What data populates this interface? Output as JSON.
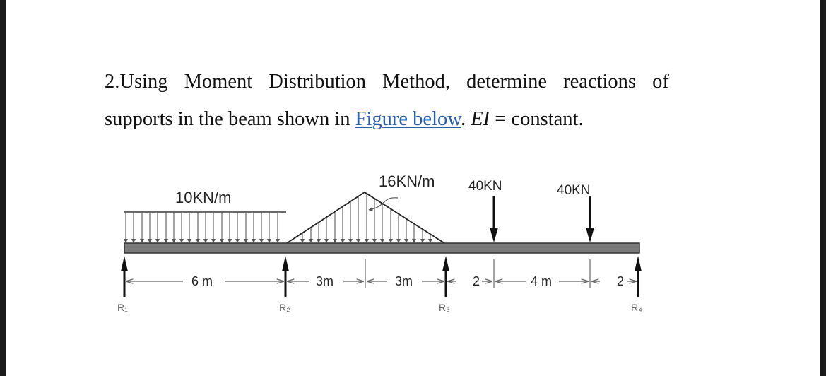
{
  "question": {
    "prefix": "2.Using Moment Distribution Method, determine reactions of",
    "line2_start": "supports in the beam shown in ",
    "link_text": "Figure below",
    "after_link": ". ",
    "ei_symbol": "EI",
    "ei_rest": " = constant."
  },
  "figure": {
    "loads": {
      "udl_label": "10KN/m",
      "triangular_label": "16KN/m",
      "point_load_1_label": "40KN",
      "point_load_2_label": "40KN"
    },
    "dimensions": {
      "span1": "6 m",
      "span2a": "3m",
      "span2b": "3m",
      "span3a": "2",
      "span3b": "4 m",
      "span3c": "2"
    },
    "supports": {
      "r1": "R₁",
      "r2": "R₂",
      "r3": "R₃",
      "r4": "R₄"
    }
  }
}
